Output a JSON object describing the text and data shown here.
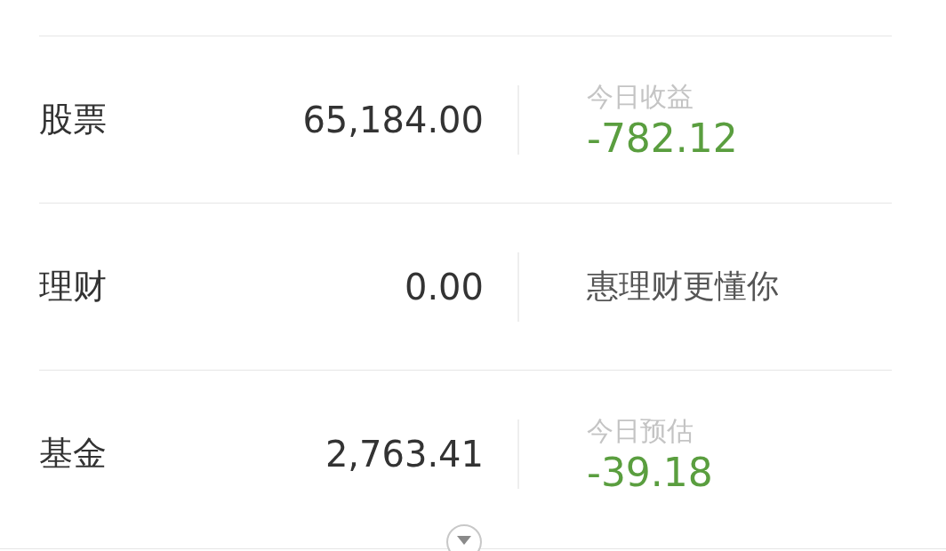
{
  "assets": [
    {
      "label": "股票",
      "amount": "65,184.00",
      "kind": "change",
      "caption": "今日收益",
      "change": "-782.12"
    },
    {
      "label": "理财",
      "amount": "0.00",
      "kind": "promo",
      "text": "惠理财更懂你"
    },
    {
      "label": "基金",
      "amount": "2,763.41",
      "kind": "change",
      "caption": "今日预估",
      "change": "-39.18"
    }
  ]
}
